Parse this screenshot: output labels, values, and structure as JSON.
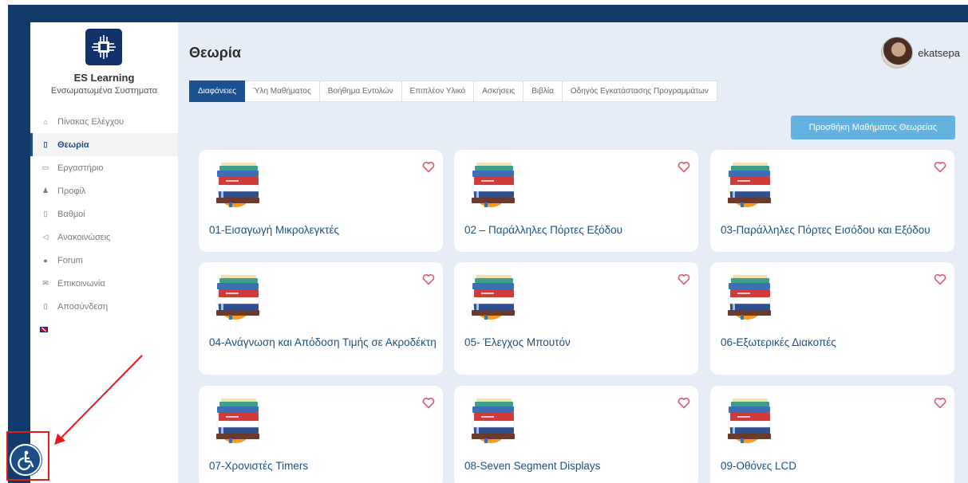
{
  "sidebar": {
    "brand_title": "ES Learning",
    "brand_subtitle": "Ενσωματωμένα Συστηματα",
    "items": [
      {
        "label": "Πίνακας Ελέγχου",
        "icon": "home-icon",
        "glyph": "⌂",
        "active": false
      },
      {
        "label": "Θεωρία",
        "icon": "book-icon",
        "glyph": "▯",
        "active": true
      },
      {
        "label": "Εργαστήριο",
        "icon": "monitor-icon",
        "glyph": "▭",
        "active": false
      },
      {
        "label": "Προφίλ",
        "icon": "user-icon",
        "glyph": "♟",
        "active": false
      },
      {
        "label": "Βαθμοί",
        "icon": "grades-icon",
        "glyph": "▯",
        "active": false
      },
      {
        "label": "Ανακοινώσεις",
        "icon": "megaphone-icon",
        "glyph": "◁",
        "active": false
      },
      {
        "label": "Forum",
        "icon": "comments-icon",
        "glyph": "●",
        "active": false
      },
      {
        "label": "Επικοινωνία",
        "icon": "envelope-icon",
        "glyph": "✉",
        "active": false
      },
      {
        "label": "Αποσύνδεση",
        "icon": "logout-icon",
        "glyph": "▯",
        "active": false
      }
    ]
  },
  "header": {
    "title": "Θεωρία",
    "username": "ekatsepa"
  },
  "tabs": [
    {
      "label": "Διαφάνειες",
      "active": true
    },
    {
      "label": "Ύλη Μαθήματος",
      "active": false
    },
    {
      "label": "Βοήθημα Εντολών",
      "active": false
    },
    {
      "label": "Επιπλέον Υλικό",
      "active": false
    },
    {
      "label": "Ασκήσεις",
      "active": false
    },
    {
      "label": "Βιβλία",
      "active": false
    },
    {
      "label": "Οδηγός Εγκατάστασης Προγραμμάτων",
      "active": false
    }
  ],
  "add_button_label": "Προσθήκη Μαθήματος Θεωρείας",
  "cards": [
    {
      "title": "01-Εισαγωγή Μικρολεγκτές"
    },
    {
      "title": "02 – Παράλληλες Πόρτες Εξόδου"
    },
    {
      "title": "03-Παράλληλες Πόρτες Εισόδου και Εξόδου"
    },
    {
      "title": "04-Ανάγνωση και Απόδοση Τιμής σε Ακροδέκτη"
    },
    {
      "title": "05- Έλεγχος Μπουτόν"
    },
    {
      "title": "06-Εξωτερικές Διακοπές"
    },
    {
      "title": "07-Χρονιστές Timers"
    },
    {
      "title": "08-Seven Segment Displays"
    },
    {
      "title": "09-Οθόνες LCD"
    }
  ],
  "colors": {
    "frame": "#123a6b",
    "accent": "#1b5190",
    "button": "#63b2df",
    "heart": "#e0556a",
    "annotation": "#e41b1b"
  }
}
